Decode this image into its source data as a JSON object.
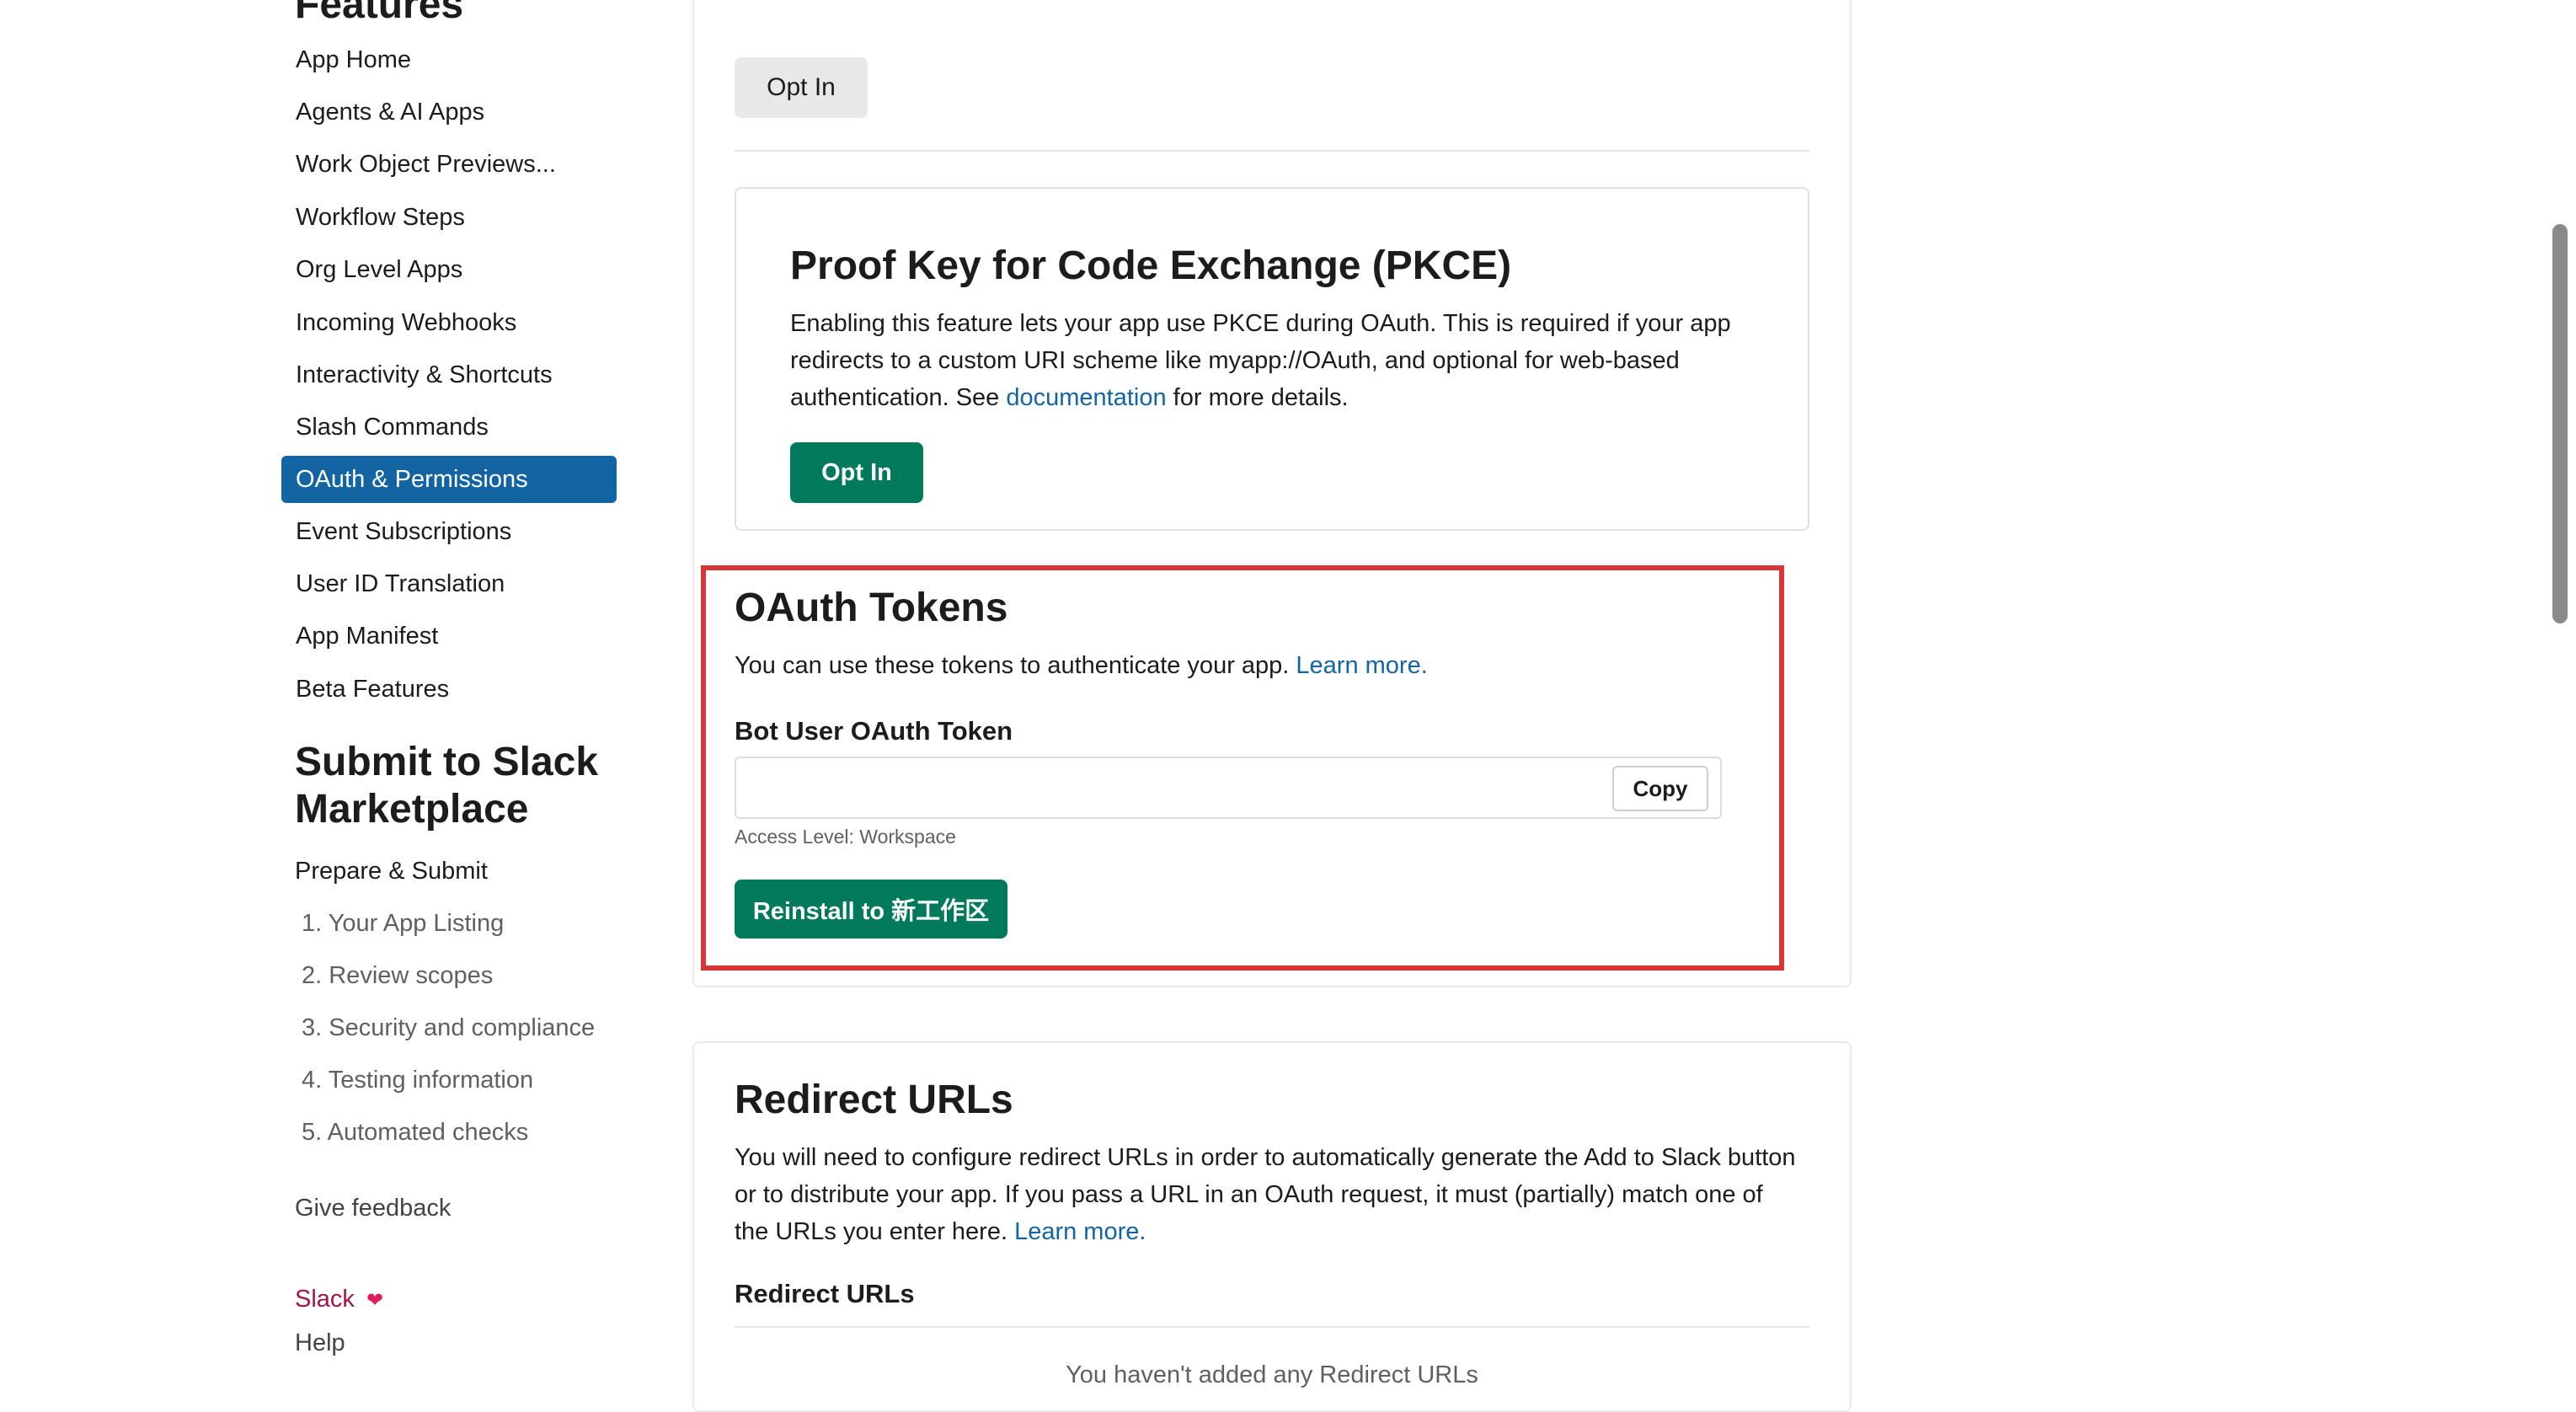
{
  "sidebar": {
    "features_heading": "Features",
    "items": [
      {
        "label": "App Home"
      },
      {
        "label": "Agents & AI Apps"
      },
      {
        "label": "Work Object Previews..."
      },
      {
        "label": "Workflow Steps"
      },
      {
        "label": "Org Level Apps"
      },
      {
        "label": "Incoming Webhooks"
      },
      {
        "label": "Interactivity & Shortcuts"
      },
      {
        "label": "Slash Commands"
      },
      {
        "label": "OAuth & Permissions",
        "active": true
      },
      {
        "label": "Event Subscriptions"
      },
      {
        "label": "User ID Translation"
      },
      {
        "label": "App Manifest"
      },
      {
        "label": "Beta Features"
      }
    ],
    "submit_heading_line1": "Submit to Slack",
    "submit_heading_line2": "Marketplace",
    "prepare_label": "Prepare & Submit",
    "steps": [
      {
        "label": "1. Your App Listing"
      },
      {
        "label": "2. Review scopes"
      },
      {
        "label": "3. Security and compliance"
      },
      {
        "label": "4. Testing information"
      },
      {
        "label": "5. Automated checks"
      }
    ],
    "feedback_label": "Give feedback",
    "slack_label": "Slack",
    "help_label": "Help"
  },
  "top": {
    "opt_in_label": "Opt In"
  },
  "pkce": {
    "title": "Proof Key for Code Exchange (PKCE)",
    "body_before_link": "Enabling this feature lets your app use PKCE during OAuth. This is required if your app redirects to a custom URI scheme like myapp://OAuth, and optional for web-based authentication. See ",
    "link_text": "documentation",
    "body_after_link": " for more details.",
    "opt_in_label": "Opt In"
  },
  "oauth_tokens": {
    "title": "OAuth Tokens",
    "description": "You can use these tokens to authenticate your app. ",
    "learn_more": "Learn more.",
    "bot_token_label": "Bot User OAuth Token",
    "token_value": "",
    "copy_label": "Copy",
    "access_level": "Access Level: Workspace",
    "reinstall_label": "Reinstall to 新工作区"
  },
  "redirect": {
    "title": "Redirect URLs",
    "description": "You will need to configure redirect URLs in order to automatically generate the Add to Slack button or to distribute your app. If you pass a URL in an OAuth request, it must (partially) match one of the URLs you enter here. ",
    "learn_more": "Learn more.",
    "subheading": "Redirect URLs",
    "empty_text": "You haven't added any Redirect URLs"
  },
  "colors": {
    "accent_blue": "#1264a3",
    "action_green": "#007a5a",
    "highlight_red": "#d63638",
    "slack_heart": "#e01e5a"
  }
}
